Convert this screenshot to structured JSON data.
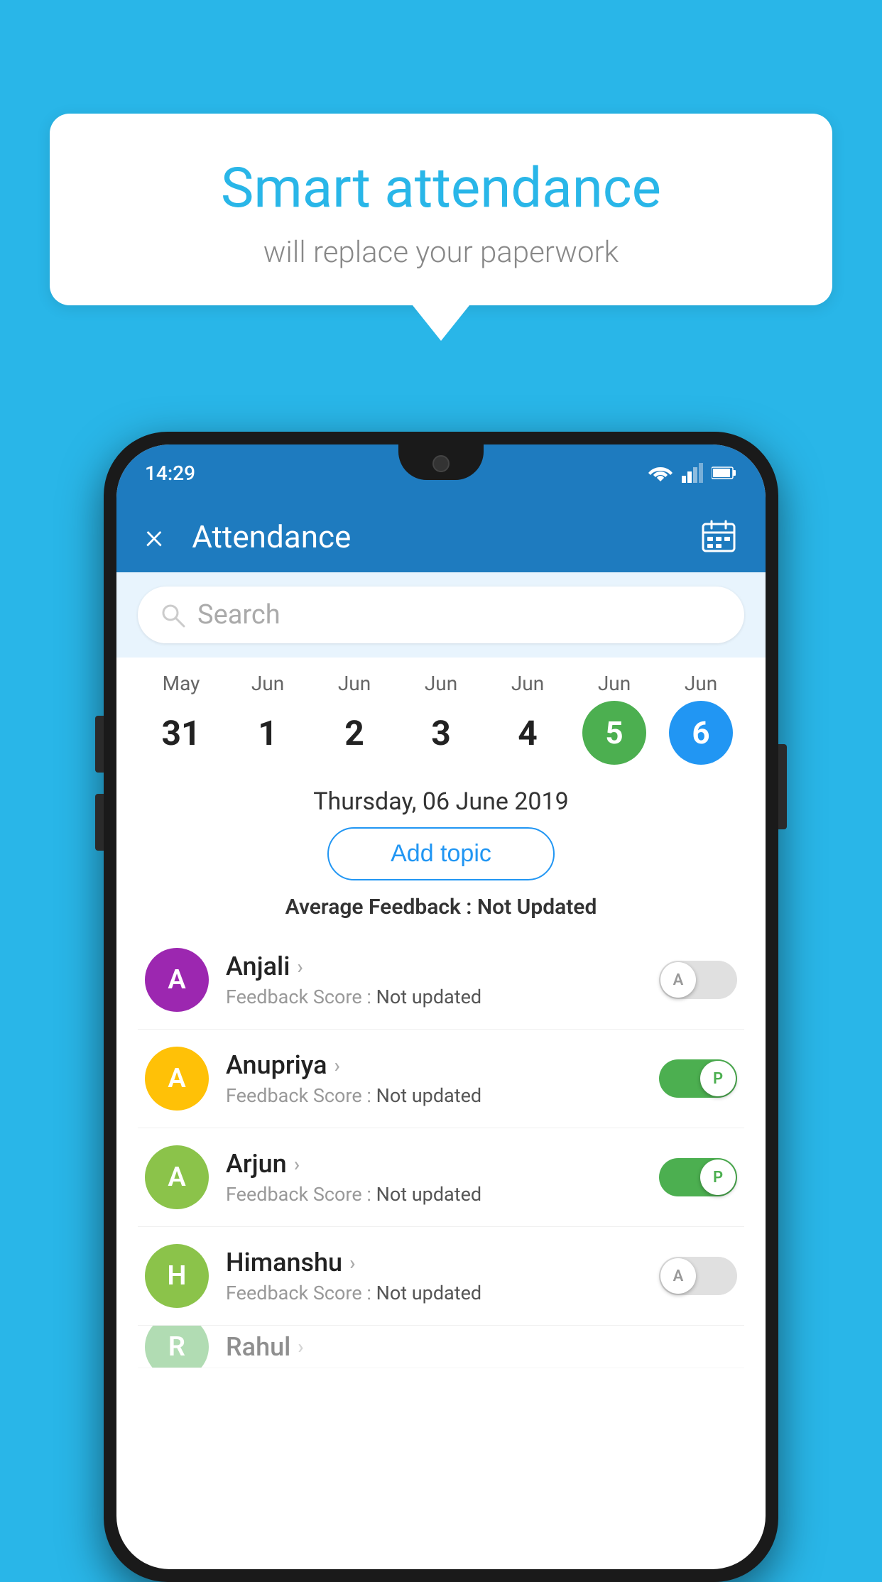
{
  "background_color": "#29b6e8",
  "speech_bubble": {
    "title": "Smart attendance",
    "subtitle": "will replace your paperwork"
  },
  "phone": {
    "status_bar": {
      "time": "14:29"
    },
    "header": {
      "title": "Attendance",
      "close_icon": "×",
      "calendar_icon": "📅"
    },
    "search": {
      "placeholder": "Search"
    },
    "calendar": {
      "dates": [
        {
          "month": "May",
          "day": "31",
          "state": "normal"
        },
        {
          "month": "Jun",
          "day": "1",
          "state": "normal"
        },
        {
          "month": "Jun",
          "day": "2",
          "state": "normal"
        },
        {
          "month": "Jun",
          "day": "3",
          "state": "normal"
        },
        {
          "month": "Jun",
          "day": "4",
          "state": "normal"
        },
        {
          "month": "Jun",
          "day": "5",
          "state": "today"
        },
        {
          "month": "Jun",
          "day": "6",
          "state": "selected"
        }
      ]
    },
    "selected_date_label": "Thursday, 06 June 2019",
    "add_topic_label": "Add topic",
    "avg_feedback_label": "Average Feedback :",
    "avg_feedback_value": "Not Updated",
    "students": [
      {
        "name": "Anjali",
        "avatar_letter": "A",
        "avatar_color": "#9C27B0",
        "feedback_label": "Feedback Score :",
        "feedback_value": "Not updated",
        "toggle": "off",
        "toggle_letter": "A"
      },
      {
        "name": "Anupriya",
        "avatar_letter": "A",
        "avatar_color": "#FFC107",
        "feedback_label": "Feedback Score :",
        "feedback_value": "Not updated",
        "toggle": "on",
        "toggle_letter": "P"
      },
      {
        "name": "Arjun",
        "avatar_letter": "A",
        "avatar_color": "#8BC34A",
        "feedback_label": "Feedback Score :",
        "feedback_value": "Not updated",
        "toggle": "on",
        "toggle_letter": "P"
      },
      {
        "name": "Himanshu",
        "avatar_letter": "H",
        "avatar_color": "#8BC34A",
        "feedback_label": "Feedback Score :",
        "feedback_value": "Not updated",
        "toggle": "off",
        "toggle_letter": "A"
      }
    ]
  }
}
